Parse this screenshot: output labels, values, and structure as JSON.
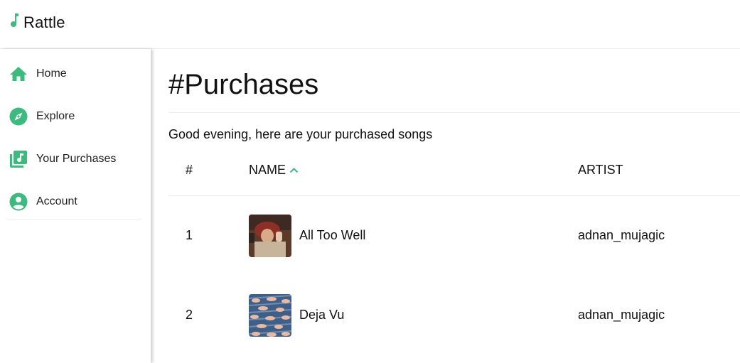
{
  "app": {
    "name": "Rattle",
    "accent": "#3dba7e"
  },
  "sidebar": {
    "items": [
      {
        "label": "Home",
        "icon": "home-icon"
      },
      {
        "label": "Explore",
        "icon": "compass-icon"
      },
      {
        "label": "Your Purchases",
        "icon": "library-music-icon"
      },
      {
        "label": "Account",
        "icon": "account-circle-icon"
      }
    ]
  },
  "main": {
    "title": "#Purchases",
    "greeting": "Good evening, here are your purchased songs",
    "columns": {
      "number": "#",
      "name": "NAME",
      "artist": "ARTIST"
    },
    "sort": {
      "column": "name",
      "direction": "ascending",
      "icon": "chevron-up-icon"
    },
    "rows": [
      {
        "number": "1",
        "name": "All Too Well",
        "artist": "adnan_mujagic"
      },
      {
        "number": "2",
        "name": "Deja Vu",
        "artist": "adnan_mujagic"
      }
    ]
  }
}
